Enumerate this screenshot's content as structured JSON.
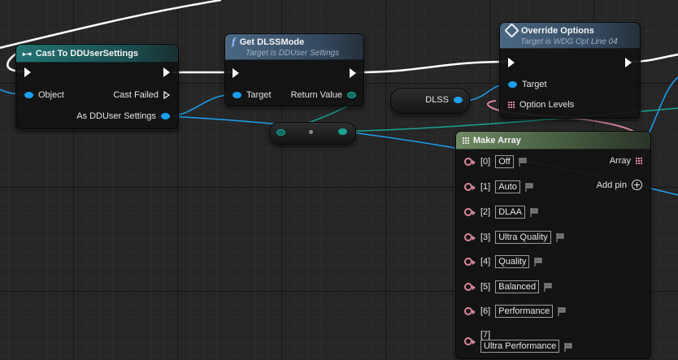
{
  "canvas": {
    "background": "#262626"
  },
  "colors": {
    "exec": "#ffffff",
    "object_pin": "#1ba0f0",
    "enum_pin": "#1aa596",
    "array_pin": "#e58aa5"
  },
  "cast_node": {
    "title": "Cast To DDUserSettings",
    "pins": {
      "object": "Object",
      "cast_failed": "Cast Failed",
      "as_settings": "As DDUser Settings"
    }
  },
  "dlss_node": {
    "title": "Get DLSSMode",
    "subtitle": "Target is DDUser Settings",
    "pins": {
      "target": "Target",
      "return": "Return Value"
    }
  },
  "override_node": {
    "title": "Override Options",
    "subtitle": "Target is WDG Opt Line 04",
    "pins": {
      "target": "Target",
      "levels": "Option Levels"
    }
  },
  "dlss_var": {
    "label": "DLSS"
  },
  "make_array": {
    "title": "Make Array",
    "output": "Array",
    "add_pin": "Add pin",
    "items": [
      {
        "index": "[0]",
        "value": "Off"
      },
      {
        "index": "[1]",
        "value": "Auto"
      },
      {
        "index": "[2]",
        "value": "DLAA"
      },
      {
        "index": "[3]",
        "value": "Ultra Quality"
      },
      {
        "index": "[4]",
        "value": "Quality"
      },
      {
        "index": "[5]",
        "value": "Balanced"
      },
      {
        "index": "[6]",
        "value": "Performance"
      },
      {
        "index": "[7]",
        "value": "Ultra Performance"
      }
    ]
  }
}
